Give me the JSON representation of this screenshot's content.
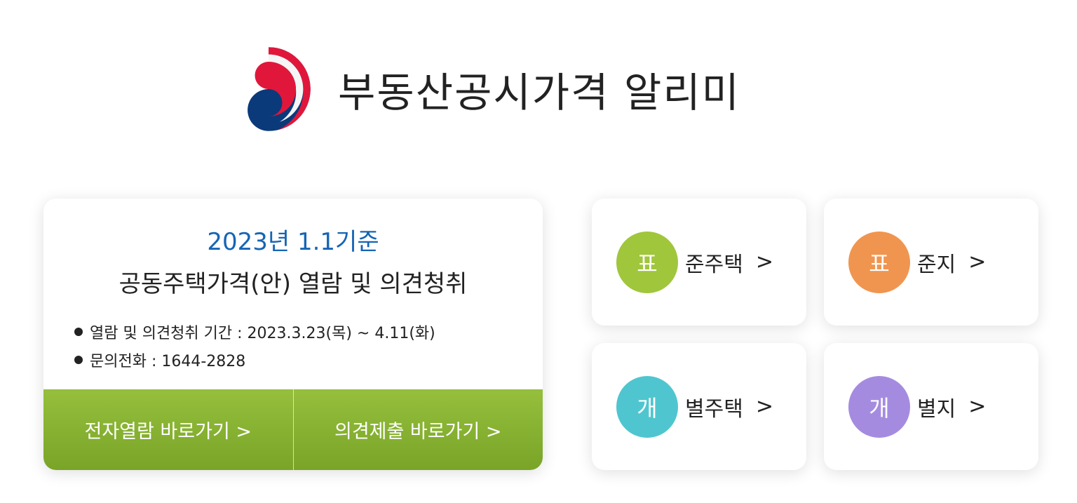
{
  "header": {
    "title": "부동산공시가격 알리미",
    "logo_icon": "korea-government-emblem-icon"
  },
  "notice": {
    "date": "2023년 1.1기준",
    "title": "공동주택가격(안) 열람 및 의견청취",
    "info": [
      "열람 및 의견청취 기간 : 2023.3.23(목) ~ 4.11(화)",
      "문의전화 : 1644-2828"
    ],
    "buttons": [
      "전자열람 바로가기 >",
      "의견제출 바로가기 >"
    ]
  },
  "tiles": [
    {
      "badge": "표",
      "label": "준주택",
      "arrow": ">",
      "color": "#a0c63c"
    },
    {
      "badge": "표",
      "label": "준지",
      "arrow": ">",
      "color": "#f0954f"
    },
    {
      "badge": "개",
      "label": "별주택",
      "arrow": ">",
      "color": "#4fc6cf"
    },
    {
      "badge": "개",
      "label": "별지",
      "arrow": ">",
      "color": "#a58be0"
    }
  ],
  "colors": {
    "accent_green": "#8bb534",
    "date_blue": "#1565b5",
    "emblem_red": "#e0173b",
    "emblem_blue": "#0a3a7a"
  }
}
